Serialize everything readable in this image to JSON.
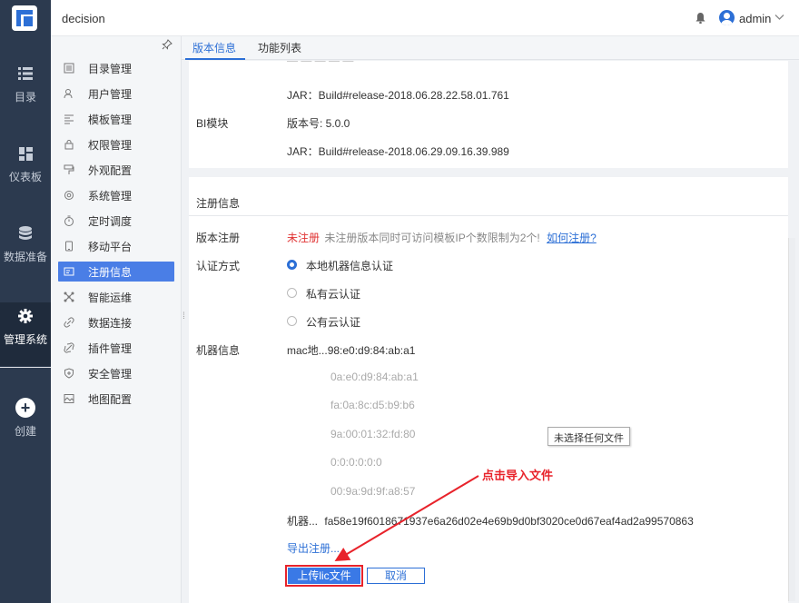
{
  "app": {
    "title": "decision"
  },
  "user": {
    "name": "admin"
  },
  "rail": [
    {
      "label": "目录",
      "icon": "list-icon"
    },
    {
      "label": "仪表板",
      "icon": "dashboard-icon"
    },
    {
      "label": "数据准备",
      "icon": "database-icon"
    },
    {
      "label": "管理系统",
      "icon": "gear-icon",
      "active": true
    },
    {
      "label": "创建",
      "icon": "plus-circle-icon"
    }
  ],
  "subnav": [
    {
      "label": "目录管理",
      "icon": "directory-icon"
    },
    {
      "label": "用户管理",
      "icon": "user-icon"
    },
    {
      "label": "模板管理",
      "icon": "template-icon"
    },
    {
      "label": "权限管理",
      "icon": "lock-icon"
    },
    {
      "label": "外观配置",
      "icon": "paint-icon"
    },
    {
      "label": "系统管理",
      "icon": "settings-icon"
    },
    {
      "label": "定时调度",
      "icon": "timer-icon"
    },
    {
      "label": "移动平台",
      "icon": "mobile-icon"
    },
    {
      "label": "注册信息",
      "icon": "register-icon",
      "active": true
    },
    {
      "label": "智能运维",
      "icon": "ops-icon"
    },
    {
      "label": "数据连接",
      "icon": "link-icon"
    },
    {
      "label": "插件管理",
      "icon": "plugin-icon"
    },
    {
      "label": "安全管理",
      "icon": "shield-icon"
    },
    {
      "label": "地图配置",
      "icon": "map-icon"
    }
  ],
  "tabs": [
    {
      "label": "版本信息",
      "active": true
    },
    {
      "label": "功能列表"
    }
  ],
  "version": {
    "jar1": "JAR：Build#release-2018.06.28.22.58.01.761",
    "bi_label": "BI模块",
    "bi_version": "版本号: 5.0.0",
    "jar2": "JAR：Build#release-2018.06.29.09.16.39.989"
  },
  "register": {
    "section_title": "注册信息",
    "version_reg_label": "版本注册",
    "status": "未注册",
    "status_note": "未注册版本同时可访问模板IP个数限制为2个!",
    "how_link": "如何注册?",
    "auth_label": "认证方式",
    "auth_options": [
      {
        "label": "本地机器信息认证",
        "selected": true
      },
      {
        "label": "私有云认证",
        "selected": false
      },
      {
        "label": "公有云认证",
        "selected": false
      }
    ],
    "machine_label": "机器信息",
    "mac_prefix": "mac地...",
    "mac_list": [
      "98:e0:d9:84:ab:a1",
      "0a:e0:d9:84:ab:a1",
      "fa:0a:8c:d5:b9:b6",
      "9a:00:01:32:fd:80",
      "0:0:0:0:0:0",
      "00:9a:9d:9f:a8:57"
    ],
    "machine_code_label": "机器...",
    "machine_code": "fa58e19f6018671937e6a26d02e4e69b9d0bf3020ce0d67eaf4ad2a99570863",
    "export_link": "导出注册...",
    "no_file_tooltip": "未选择任何文件",
    "upload_button": "上传lic文件",
    "cancel_button": "取消"
  },
  "annotation": {
    "text": "点击导入文件",
    "color": "#e8232b"
  },
  "colors": {
    "accent": "#2c6fd6",
    "rail_bg": "#2c3a4f",
    "active_item": "#4a7ee6",
    "error": "#e03131"
  }
}
